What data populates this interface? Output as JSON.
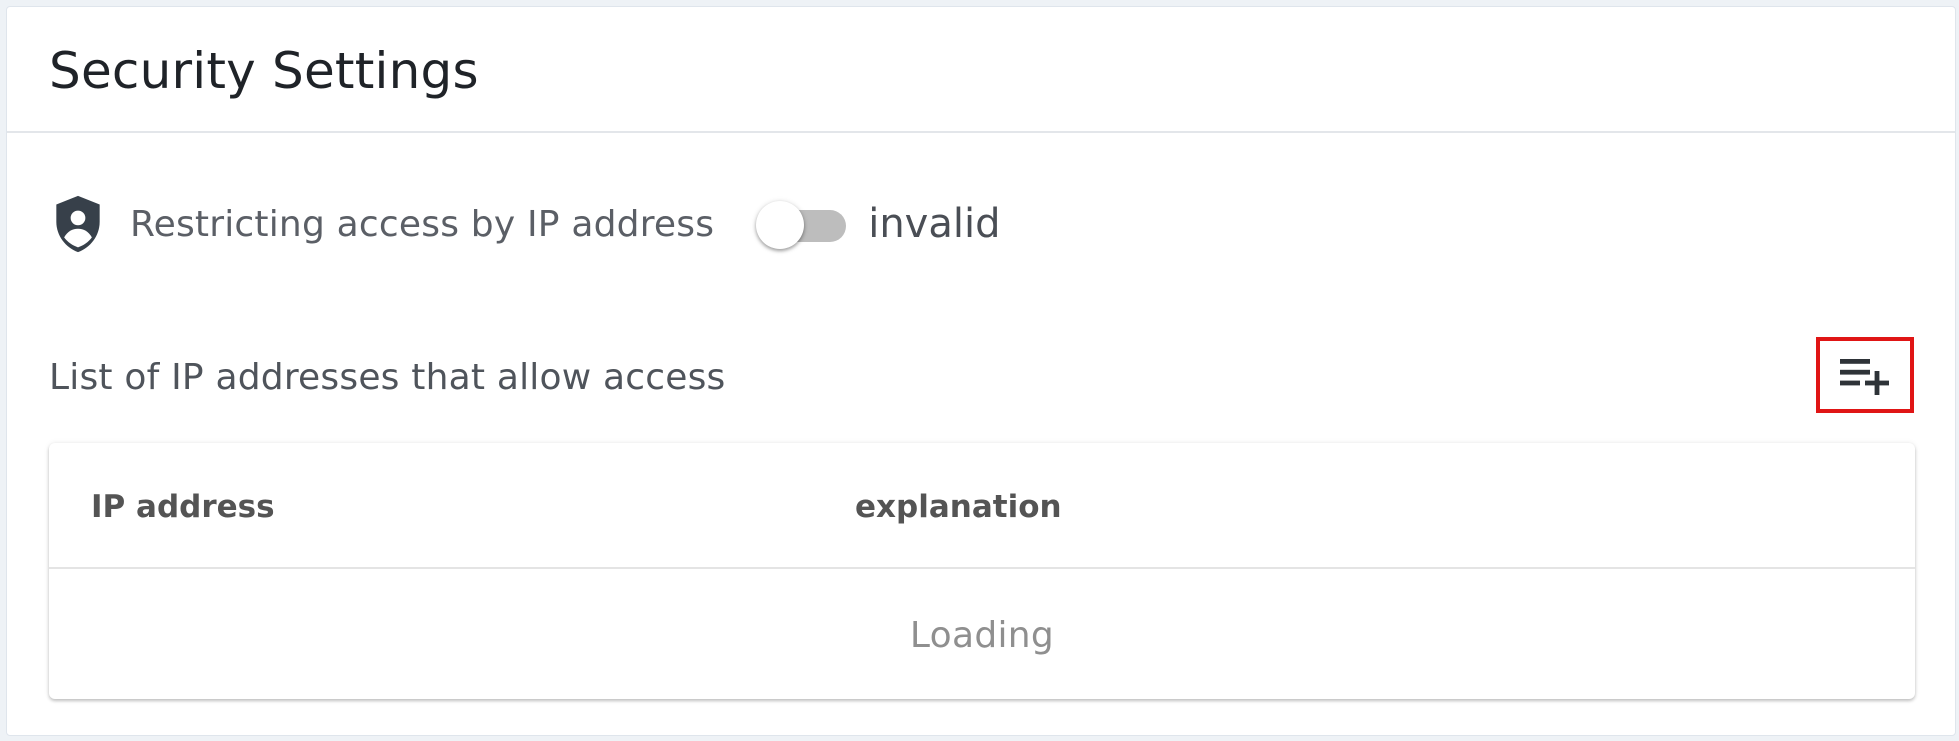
{
  "page": {
    "title": "Security Settings"
  },
  "ip_restriction": {
    "label": "Restricting access by IP address",
    "toggle_on": false,
    "state_text": "invalid",
    "icon": "shield-account-icon"
  },
  "allow_list": {
    "title": "List of IP addresses that allow access",
    "add_icon": "playlist-add-icon",
    "table": {
      "columns": [
        "IP address",
        "explanation"
      ],
      "empty_text": "Loading"
    }
  },
  "colors": {
    "highlight_border": "#e01515",
    "icon_dark": "#37404a",
    "toggle_track": "#bdbdbd"
  }
}
